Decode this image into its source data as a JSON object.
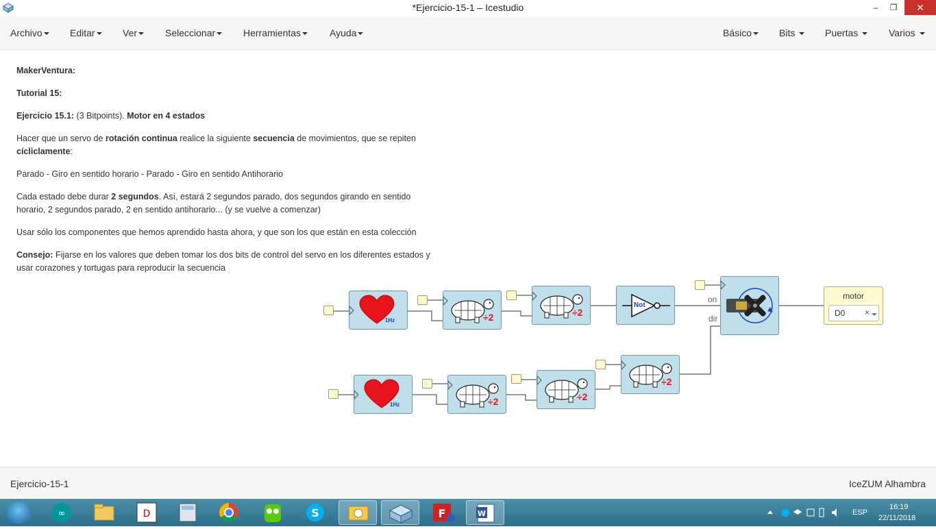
{
  "window": {
    "title": "*Ejercicio-15-1 – Icestudio",
    "minimize": "–",
    "maximize": "❐",
    "close": "✕"
  },
  "menu": {
    "left": [
      "Archivo",
      "Editar",
      "Ver",
      "Seleccionar",
      "Herramientas",
      "Ayuda"
    ],
    "right": [
      "Básico",
      "Bits",
      "Puertas",
      "Varios"
    ]
  },
  "info": {
    "line1_bold": "MakerVentura:",
    "line2_bold": "Tutorial 15:",
    "line3_bold1": "Ejercicio 15.1:",
    "line3_text": " (3 Bitpoints). ",
    "line3_bold2": "Motor en 4 estados",
    "p4_a": "Hacer que un servo de ",
    "p4_b": "rotación continua",
    "p4_c": " realice la siguiente ",
    "p4_d": "secuencia",
    "p4_e": " de movimientos, que se repiten ",
    "p4_f": "cícliclamente",
    "p4_g": ":",
    "p5": "Parado - Giro en sentido horario - Parado - Giro en sentido Antihorario",
    "p6_a": "Cada estado debe durar ",
    "p6_b": "2 segundos",
    "p6_c": ". Así, estará 2 segundos parado, dos segundos girando en sentido horario, 2 segundos parado, 2 en sentido antihorario... (y se vuelve a comenzar)",
    "p7": "Usar sólo los componentes que hemos aprendido hasta ahora, y que son los que están en esta colección",
    "p8_bold": "Consejo:",
    "p8_text": " Fijarse en los valores que deben tomar los dos bits de control del servo en los diferentes estados y usar corazones y tortugas para reproducir la secuencia"
  },
  "circuit": {
    "heart_label": "1Hz",
    "divider_label": "÷2",
    "not_label": "Not",
    "port_on": "on",
    "port_dir": "dir",
    "output_name": "motor",
    "output_pin": "D0",
    "output_clear": "×"
  },
  "status": {
    "project": "Ejercicio-15-1",
    "board": "IceZUM Alhambra"
  },
  "taskbar": {
    "lang": "ESP",
    "time": "16:19",
    "date": "22/11/2018"
  },
  "colors": {
    "block_fill": "#bfdfea",
    "block_border": "#6f97a7",
    "pin_fill": "#fffbd1",
    "heart": "#e8141c",
    "divider_text": "#e8141c",
    "taskbar": "#3a7e99"
  }
}
